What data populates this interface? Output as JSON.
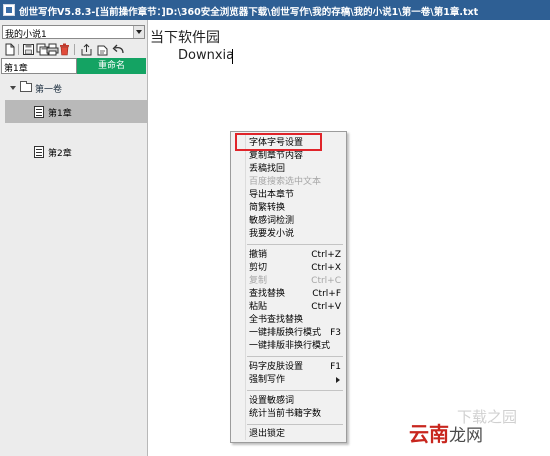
{
  "window": {
    "title": "创世写作V5.8.3-[当前操作章节：]D:\\360安全浏览器下载\\创世写作\\我的存稿\\我的小说1\\第一卷\\第1章.txt"
  },
  "sidebar": {
    "book_select": "我的小说1",
    "toolbar_icons": [
      "new-document-icon",
      "save-icon",
      "save-all-icon",
      "print-icon",
      "delete-icon",
      "export-icon",
      "share-icon",
      "undo-icon"
    ],
    "chapter_input": "第1章",
    "rename_label": "重命名",
    "tree": {
      "volume": "第一卷",
      "chapters": [
        {
          "label": "第1章",
          "selected": true
        },
        {
          "label": "第2章",
          "selected": false
        }
      ]
    }
  },
  "editor": {
    "line1": "当下软件园",
    "line2": "Downxia"
  },
  "context_menu": {
    "items": [
      {
        "label": "字体字号设置"
      },
      {
        "label": "复制章节内容"
      },
      {
        "label": "丢稿找回"
      },
      {
        "label": "百度搜索选中文本",
        "disabled": true
      },
      {
        "label": "导出本章节"
      },
      {
        "label": "简繁转换"
      },
      {
        "label": "敏感词检测"
      },
      {
        "label": "我要发小说"
      },
      {
        "label": "撤销",
        "shortcut": "Ctrl+Z"
      },
      {
        "label": "剪切",
        "shortcut": "Ctrl+X"
      },
      {
        "label": "复制",
        "shortcut": "Ctrl+C",
        "disabled": true
      },
      {
        "label": "查找替换",
        "shortcut": "Ctrl+F"
      },
      {
        "label": "粘贴",
        "shortcut": "Ctrl+V"
      },
      {
        "label": "全书查找替换"
      },
      {
        "label": "一键排版换行模式",
        "shortcut": "F3"
      },
      {
        "label": "一键排版非换行模式"
      },
      {
        "label": "码字皮肤设置",
        "shortcut": "F1"
      },
      {
        "label": "强制写作",
        "submenu": true
      },
      {
        "label": "设置敏感词"
      },
      {
        "label": "统计当前书籍字数"
      },
      {
        "label": "退出锁定"
      }
    ]
  },
  "highlight_color": "#e0242a",
  "accent_color": "#14a363",
  "watermark": {
    "faint": "下载之园",
    "brand": "云南",
    "dragon": "龙",
    "site": "网"
  }
}
